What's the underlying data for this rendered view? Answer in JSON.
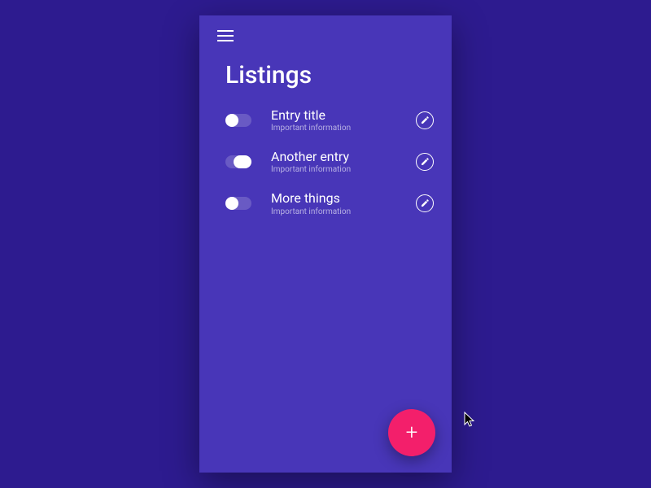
{
  "title": "Listings",
  "entries": [
    {
      "title": "Entry title",
      "subtitle": "Important information",
      "toggled": false
    },
    {
      "title": "Another entry",
      "subtitle": "Important information",
      "toggled": true
    },
    {
      "title": "More things",
      "subtitle": "Important information",
      "toggled": false
    }
  ],
  "colors": {
    "background": "#2d1b8f",
    "surface": "#4836b8",
    "accent": "#f31f6b"
  }
}
